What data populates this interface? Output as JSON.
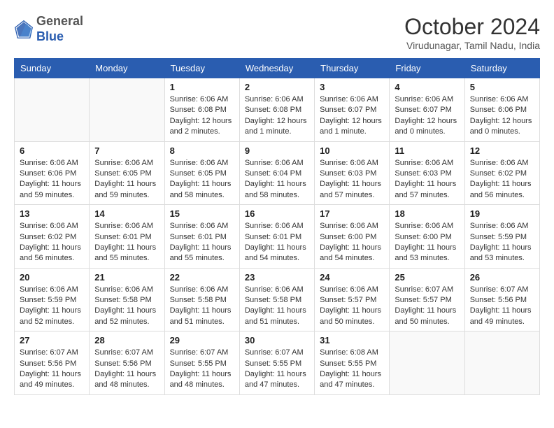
{
  "header": {
    "logo_general": "General",
    "logo_blue": "Blue",
    "month_title": "October 2024",
    "location": "Virudunagar, Tamil Nadu, India"
  },
  "days_of_week": [
    "Sunday",
    "Monday",
    "Tuesday",
    "Wednesday",
    "Thursday",
    "Friday",
    "Saturday"
  ],
  "weeks": [
    [
      {
        "day": "",
        "lines": []
      },
      {
        "day": "",
        "lines": []
      },
      {
        "day": "1",
        "lines": [
          "Sunrise: 6:06 AM",
          "Sunset: 6:08 PM",
          "Daylight: 12 hours",
          "and 2 minutes."
        ]
      },
      {
        "day": "2",
        "lines": [
          "Sunrise: 6:06 AM",
          "Sunset: 6:08 PM",
          "Daylight: 12 hours",
          "and 1 minute."
        ]
      },
      {
        "day": "3",
        "lines": [
          "Sunrise: 6:06 AM",
          "Sunset: 6:07 PM",
          "Daylight: 12 hours",
          "and 1 minute."
        ]
      },
      {
        "day": "4",
        "lines": [
          "Sunrise: 6:06 AM",
          "Sunset: 6:07 PM",
          "Daylight: 12 hours",
          "and 0 minutes."
        ]
      },
      {
        "day": "5",
        "lines": [
          "Sunrise: 6:06 AM",
          "Sunset: 6:06 PM",
          "Daylight: 12 hours",
          "and 0 minutes."
        ]
      }
    ],
    [
      {
        "day": "6",
        "lines": [
          "Sunrise: 6:06 AM",
          "Sunset: 6:06 PM",
          "Daylight: 11 hours",
          "and 59 minutes."
        ]
      },
      {
        "day": "7",
        "lines": [
          "Sunrise: 6:06 AM",
          "Sunset: 6:05 PM",
          "Daylight: 11 hours",
          "and 59 minutes."
        ]
      },
      {
        "day": "8",
        "lines": [
          "Sunrise: 6:06 AM",
          "Sunset: 6:05 PM",
          "Daylight: 11 hours",
          "and 58 minutes."
        ]
      },
      {
        "day": "9",
        "lines": [
          "Sunrise: 6:06 AM",
          "Sunset: 6:04 PM",
          "Daylight: 11 hours",
          "and 58 minutes."
        ]
      },
      {
        "day": "10",
        "lines": [
          "Sunrise: 6:06 AM",
          "Sunset: 6:03 PM",
          "Daylight: 11 hours",
          "and 57 minutes."
        ]
      },
      {
        "day": "11",
        "lines": [
          "Sunrise: 6:06 AM",
          "Sunset: 6:03 PM",
          "Daylight: 11 hours",
          "and 57 minutes."
        ]
      },
      {
        "day": "12",
        "lines": [
          "Sunrise: 6:06 AM",
          "Sunset: 6:02 PM",
          "Daylight: 11 hours",
          "and 56 minutes."
        ]
      }
    ],
    [
      {
        "day": "13",
        "lines": [
          "Sunrise: 6:06 AM",
          "Sunset: 6:02 PM",
          "Daylight: 11 hours",
          "and 56 minutes."
        ]
      },
      {
        "day": "14",
        "lines": [
          "Sunrise: 6:06 AM",
          "Sunset: 6:01 PM",
          "Daylight: 11 hours",
          "and 55 minutes."
        ]
      },
      {
        "day": "15",
        "lines": [
          "Sunrise: 6:06 AM",
          "Sunset: 6:01 PM",
          "Daylight: 11 hours",
          "and 55 minutes."
        ]
      },
      {
        "day": "16",
        "lines": [
          "Sunrise: 6:06 AM",
          "Sunset: 6:01 PM",
          "Daylight: 11 hours",
          "and 54 minutes."
        ]
      },
      {
        "day": "17",
        "lines": [
          "Sunrise: 6:06 AM",
          "Sunset: 6:00 PM",
          "Daylight: 11 hours",
          "and 54 minutes."
        ]
      },
      {
        "day": "18",
        "lines": [
          "Sunrise: 6:06 AM",
          "Sunset: 6:00 PM",
          "Daylight: 11 hours",
          "and 53 minutes."
        ]
      },
      {
        "day": "19",
        "lines": [
          "Sunrise: 6:06 AM",
          "Sunset: 5:59 PM",
          "Daylight: 11 hours",
          "and 53 minutes."
        ]
      }
    ],
    [
      {
        "day": "20",
        "lines": [
          "Sunrise: 6:06 AM",
          "Sunset: 5:59 PM",
          "Daylight: 11 hours",
          "and 52 minutes."
        ]
      },
      {
        "day": "21",
        "lines": [
          "Sunrise: 6:06 AM",
          "Sunset: 5:58 PM",
          "Daylight: 11 hours",
          "and 52 minutes."
        ]
      },
      {
        "day": "22",
        "lines": [
          "Sunrise: 6:06 AM",
          "Sunset: 5:58 PM",
          "Daylight: 11 hours",
          "and 51 minutes."
        ]
      },
      {
        "day": "23",
        "lines": [
          "Sunrise: 6:06 AM",
          "Sunset: 5:58 PM",
          "Daylight: 11 hours",
          "and 51 minutes."
        ]
      },
      {
        "day": "24",
        "lines": [
          "Sunrise: 6:06 AM",
          "Sunset: 5:57 PM",
          "Daylight: 11 hours",
          "and 50 minutes."
        ]
      },
      {
        "day": "25",
        "lines": [
          "Sunrise: 6:07 AM",
          "Sunset: 5:57 PM",
          "Daylight: 11 hours",
          "and 50 minutes."
        ]
      },
      {
        "day": "26",
        "lines": [
          "Sunrise: 6:07 AM",
          "Sunset: 5:56 PM",
          "Daylight: 11 hours",
          "and 49 minutes."
        ]
      }
    ],
    [
      {
        "day": "27",
        "lines": [
          "Sunrise: 6:07 AM",
          "Sunset: 5:56 PM",
          "Daylight: 11 hours",
          "and 49 minutes."
        ]
      },
      {
        "day": "28",
        "lines": [
          "Sunrise: 6:07 AM",
          "Sunset: 5:56 PM",
          "Daylight: 11 hours",
          "and 48 minutes."
        ]
      },
      {
        "day": "29",
        "lines": [
          "Sunrise: 6:07 AM",
          "Sunset: 5:55 PM",
          "Daylight: 11 hours",
          "and 48 minutes."
        ]
      },
      {
        "day": "30",
        "lines": [
          "Sunrise: 6:07 AM",
          "Sunset: 5:55 PM",
          "Daylight: 11 hours",
          "and 47 minutes."
        ]
      },
      {
        "day": "31",
        "lines": [
          "Sunrise: 6:08 AM",
          "Sunset: 5:55 PM",
          "Daylight: 11 hours",
          "and 47 minutes."
        ]
      },
      {
        "day": "",
        "lines": []
      },
      {
        "day": "",
        "lines": []
      }
    ]
  ]
}
